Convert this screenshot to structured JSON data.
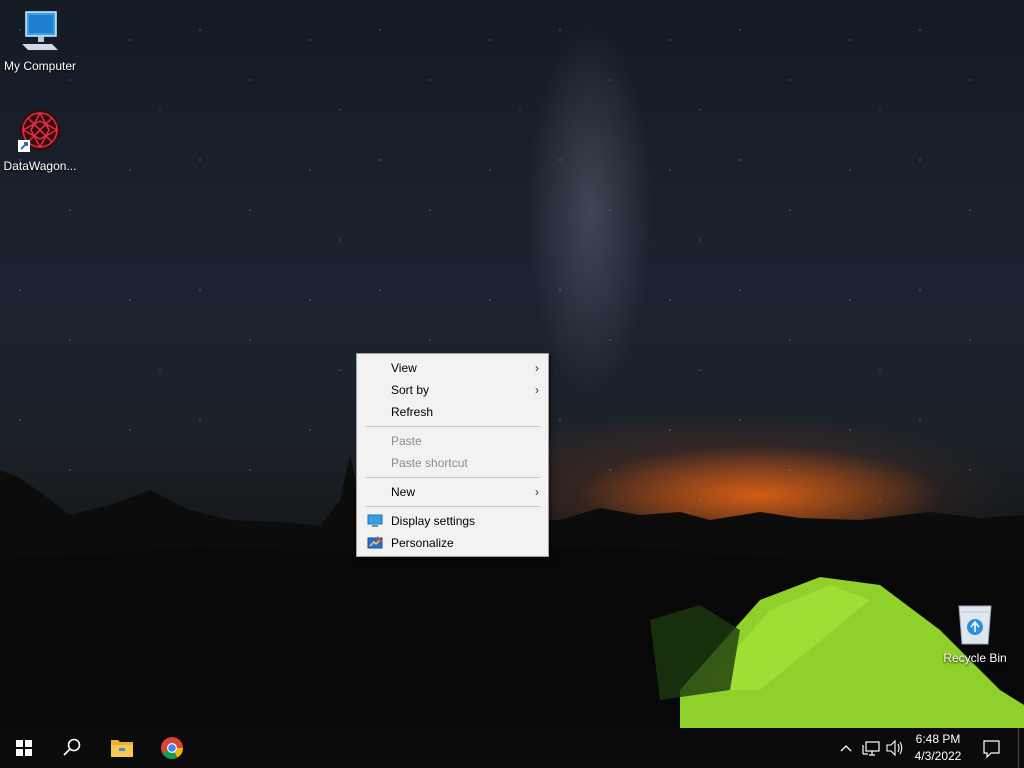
{
  "desktop": {
    "icons": [
      {
        "label": "My Computer",
        "icon": "computer-icon"
      },
      {
        "label": "DataWagon...",
        "icon": "datawagon-icon"
      },
      {
        "label": "Recycle Bin",
        "icon": "recycle-bin-icon"
      }
    ]
  },
  "context_menu": {
    "items": [
      {
        "label": "View",
        "submenu": true
      },
      {
        "label": "Sort by",
        "submenu": true
      },
      {
        "label": "Refresh"
      },
      {
        "label": "Paste",
        "disabled": true
      },
      {
        "label": "Paste shortcut",
        "disabled": true
      },
      {
        "label": "New",
        "submenu": true
      },
      {
        "label": "Display settings",
        "icon": "display-icon"
      },
      {
        "label": "Personalize",
        "icon": "personalize-icon"
      }
    ],
    "submenu_arrow": "›"
  },
  "taskbar": {
    "clock": {
      "time": "6:48 PM",
      "date": "4/3/2022"
    },
    "icons": [
      "start-icon",
      "search-icon",
      "file-explorer-icon",
      "chrome-icon",
      "chevron-up-icon",
      "network-icon",
      "volume-icon",
      "notifications-icon"
    ]
  },
  "colors": {
    "menu_bg": "#f2f2f2",
    "taskbar_bg": "#0b0b0b",
    "disabled_text": "#8d8d8d"
  }
}
